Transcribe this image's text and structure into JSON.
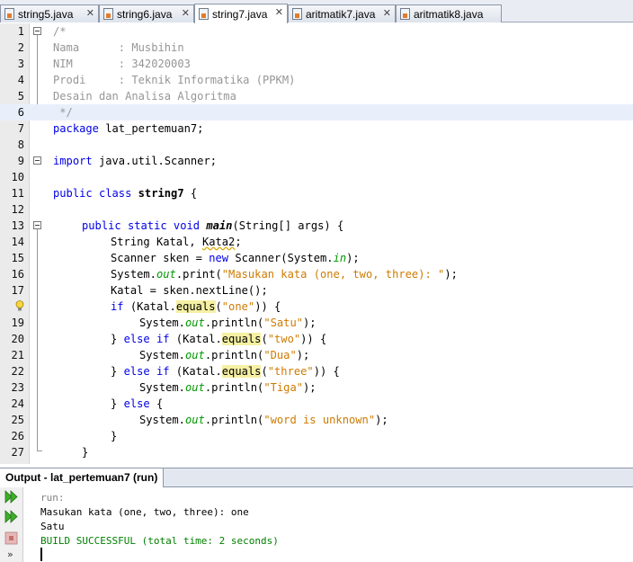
{
  "tabs": [
    {
      "label": "string5.java",
      "close": "✕"
    },
    {
      "label": "string6.java",
      "close": "✕"
    },
    {
      "label": "string7.java",
      "close": "✕",
      "active": true
    },
    {
      "label": "aritmatik7.java",
      "close": "✕"
    },
    {
      "label": "aritmatik8.java",
      "close": "✕"
    }
  ],
  "code": {
    "line_numbers": [
      "1",
      "2",
      "3",
      "4",
      "5",
      "6",
      "7",
      "8",
      "9",
      "10",
      "11",
      "12",
      "13",
      "14",
      "15",
      "16",
      "17",
      "18",
      "19",
      "20",
      "21",
      "22",
      "23",
      "24",
      "25",
      "26",
      "27"
    ],
    "l1": "/*",
    "l2": "Nama      : Musbihin",
    "l3": "NIM       : 342020003",
    "l4": "Prodi     : Teknik Informatika (PPKM)",
    "l5": "Desain dan Analisa Algoritma",
    "l6": " */",
    "l7_kw": "package",
    "l7_rest": " lat_pertemuan7;",
    "l9_kw": "import",
    "l9_rest": " java.util.Scanner;",
    "l11_kw": "public class",
    "l11_name": "string7",
    "l11_rest": " {",
    "l13_kw": "public static void",
    "l13_name": "main",
    "l13_rest": "(String[] args) {",
    "l14_a": "String Katal, ",
    "l14_b": "Kata2",
    "l14_c": ";",
    "l15_a": "Scanner sken = ",
    "l15_kw": "new",
    "l15_b": " Scanner(System.",
    "l15_fld": "in",
    "l15_c": ");",
    "l16_a": "System.",
    "l16_fld": "out",
    "l16_b": ".print(",
    "l16_str": "\"Masukan kata (one, two, three): \"",
    "l16_c": ");",
    "l17": "Katal = sken.nextLine();",
    "l18_kw": "if",
    "l18_a": " (Katal.",
    "l18_eq": "equals",
    "l18_b": "(",
    "l18_str": "\"one\"",
    "l18_c": ")) {",
    "l19_a": "System.",
    "l19_fld": "out",
    "l19_b": ".println(",
    "l19_str": "\"Satu\"",
    "l19_c": ");",
    "l20_a": "} ",
    "l20_kw": "else if",
    "l20_b": " (Katal.",
    "l20_eq": "equals",
    "l20_c": "(",
    "l20_str": "\"two\"",
    "l20_d": ")) {",
    "l21_a": "System.",
    "l21_fld": "out",
    "l21_b": ".println(",
    "l21_str": "\"Dua\"",
    "l21_c": ");",
    "l22_a": "} ",
    "l22_kw": "else if",
    "l22_b": " (Katal.",
    "l22_eq": "equals",
    "l22_c": "(",
    "l22_str": "\"three\"",
    "l22_d": ")) {",
    "l23_a": "System.",
    "l23_fld": "out",
    "l23_b": ".println(",
    "l23_str": "\"Tiga\"",
    "l23_c": ");",
    "l24_a": "} ",
    "l24_kw": "else",
    "l24_b": " {",
    "l25_a": "System.",
    "l25_fld": "out",
    "l25_b": ".println(",
    "l25_str": "\"word is unknown\"",
    "l25_c": ");",
    "l26": "}",
    "l27": "}"
  },
  "output": {
    "title": "Output - lat_pertemuan7 (run)",
    "lines": {
      "run": "run:",
      "prompt": "Masukan kata (one, two, three): one",
      "result": "Satu",
      "build": "BUILD SUCCESSFUL (total time: 2 seconds)"
    },
    "more": "»"
  },
  "colors": {
    "keyword": "#0000e6",
    "string": "#ce7b00",
    "comment": "#969696",
    "field": "#009900",
    "highlight": "#f5f0a3"
  },
  "icons": [
    "java-file-icon",
    "close-icon",
    "fold-icon",
    "lightbulb-hint-icon",
    "rerun-icon",
    "stop-icon"
  ]
}
